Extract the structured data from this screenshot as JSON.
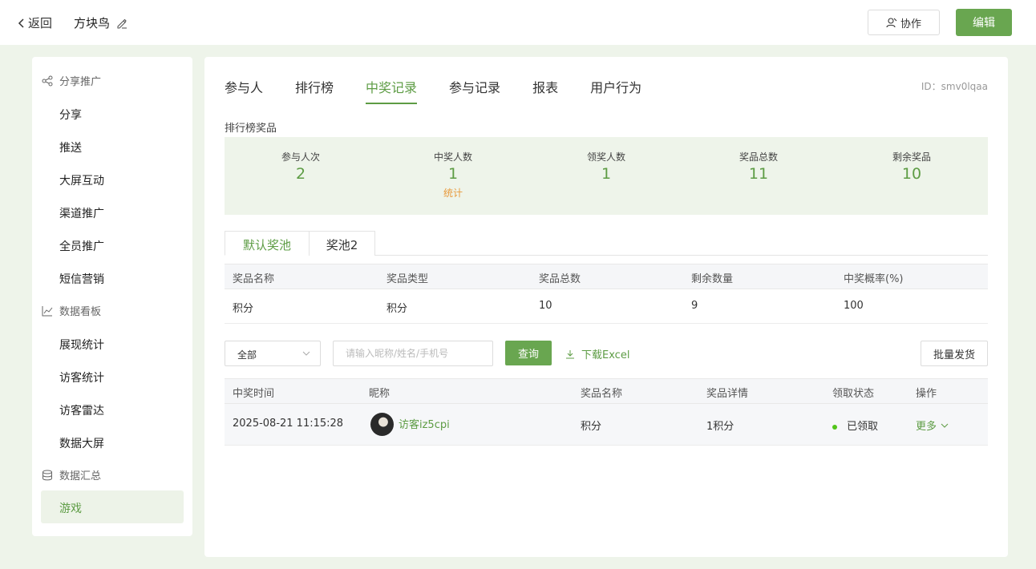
{
  "topbar": {
    "back_label": "返回",
    "title": "方块鸟",
    "collab_label": "协作",
    "edit_label": "编辑"
  },
  "sidebar": {
    "groups": [
      {
        "label": "分享推广",
        "icon": "share-icon"
      },
      {
        "label": "数据看板",
        "icon": "chart-icon"
      },
      {
        "label": "数据汇总",
        "icon": "database-icon"
      }
    ],
    "items": [
      "分享",
      "推送",
      "大屏互动",
      "渠道推广",
      "全员推广",
      "短信营销",
      "展现统计",
      "访客统计",
      "访客雷达",
      "数据大屏",
      "游戏"
    ]
  },
  "tabs": [
    "参与人",
    "排行榜",
    "中奖记录",
    "参与记录",
    "报表",
    "用户行为"
  ],
  "active_tab": "中奖记录",
  "page_id": "ID：smv0lqaa",
  "section_label": "排行榜奖品",
  "stats": [
    {
      "label": "参与人次",
      "value": "2"
    },
    {
      "label": "中奖人数",
      "value": "1",
      "extra": "统计"
    },
    {
      "label": "领奖人数",
      "value": "1"
    },
    {
      "label": "奖品总数",
      "value": "11"
    },
    {
      "label": "剩余奖品",
      "value": "10"
    }
  ],
  "pool_tabs": [
    "默认奖池",
    "奖池2"
  ],
  "prize_table": {
    "headers": [
      "奖品名称",
      "奖品类型",
      "奖品总数",
      "剩余数量",
      "中奖概率(%)"
    ],
    "rows": [
      [
        "积分",
        "积分",
        "10",
        "9",
        "100"
      ]
    ]
  },
  "filters": {
    "select_value": "全部",
    "search_placeholder": "请输入昵称/姓名/手机号",
    "query_label": "查询",
    "download_label": "下载Excel",
    "batch_label": "批量发货"
  },
  "winners_table": {
    "headers": [
      "中奖时间",
      "昵称",
      "奖品名称",
      "奖品详情",
      "领取状态",
      "操作"
    ],
    "rows": [
      {
        "time": "2025-08-21 11:15:28",
        "nickname": "访客iz5cpi",
        "prize": "积分",
        "detail": "1积分",
        "status": "已领取",
        "action": "更多"
      }
    ]
  },
  "colors": {
    "accent": "#69a650",
    "accent_text": "#5d9c44",
    "stat_extra": "#e89a3c",
    "status_dot": "#52c41a",
    "panel_bg": "#eef4ea"
  }
}
